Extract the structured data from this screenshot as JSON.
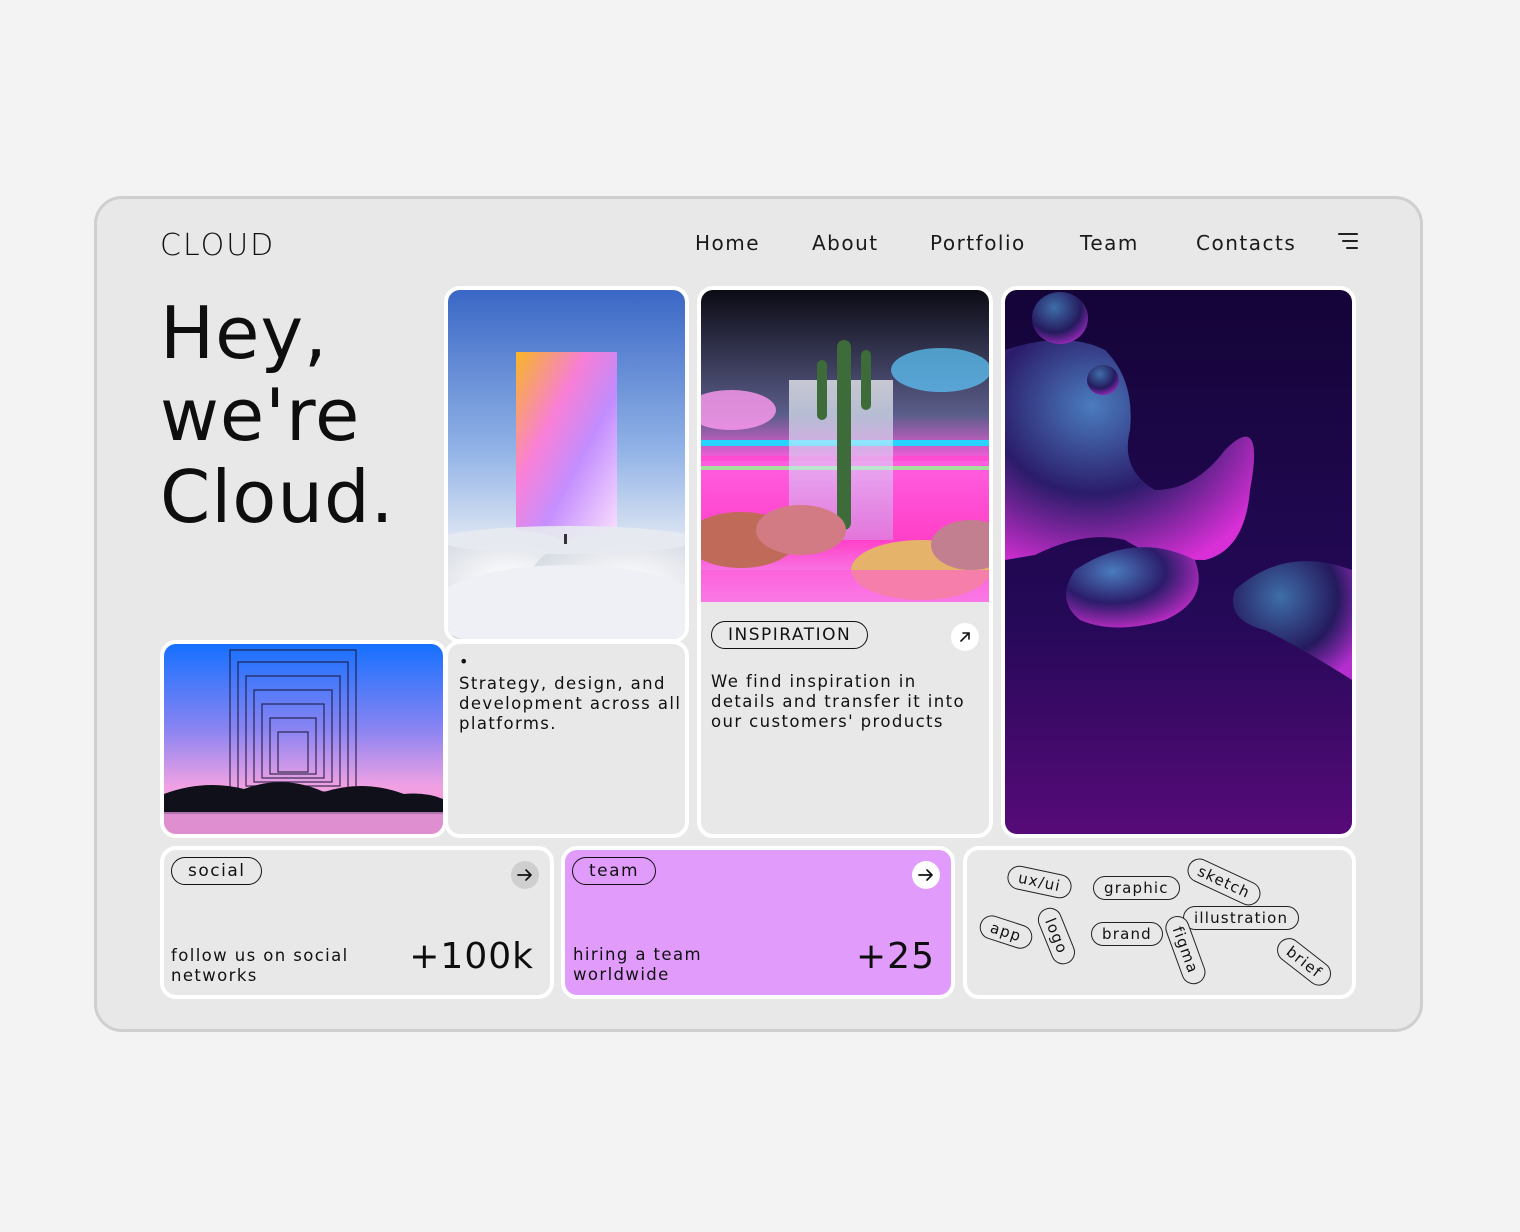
{
  "brand": {
    "logo": "CLOUD"
  },
  "nav": {
    "items": [
      "Home",
      "About",
      "Portfolio",
      "Team",
      "Contacts"
    ]
  },
  "hero": {
    "line1": "Hey,",
    "line2": "we're",
    "line3": "Cloud."
  },
  "strategy": {
    "bullet": "•",
    "text": "Strategy, design, and development across all platforms."
  },
  "inspiration": {
    "badge": "INSPIRATION",
    "text": "We find inspiration in details and transfer it into our customers' products"
  },
  "social": {
    "badge": "social",
    "caption": "follow us on social networks",
    "stat": "+100k"
  },
  "team": {
    "badge": "team",
    "caption": "hiring a team worldwide",
    "stat": "+25"
  },
  "tags": [
    "ux/ui",
    "graphic",
    "sketch",
    "app",
    "logo",
    "illustration",
    "brand",
    "figma",
    "brief"
  ],
  "colors": {
    "team_card": "#e09bfb",
    "accent_purple": "#8a2be2"
  }
}
